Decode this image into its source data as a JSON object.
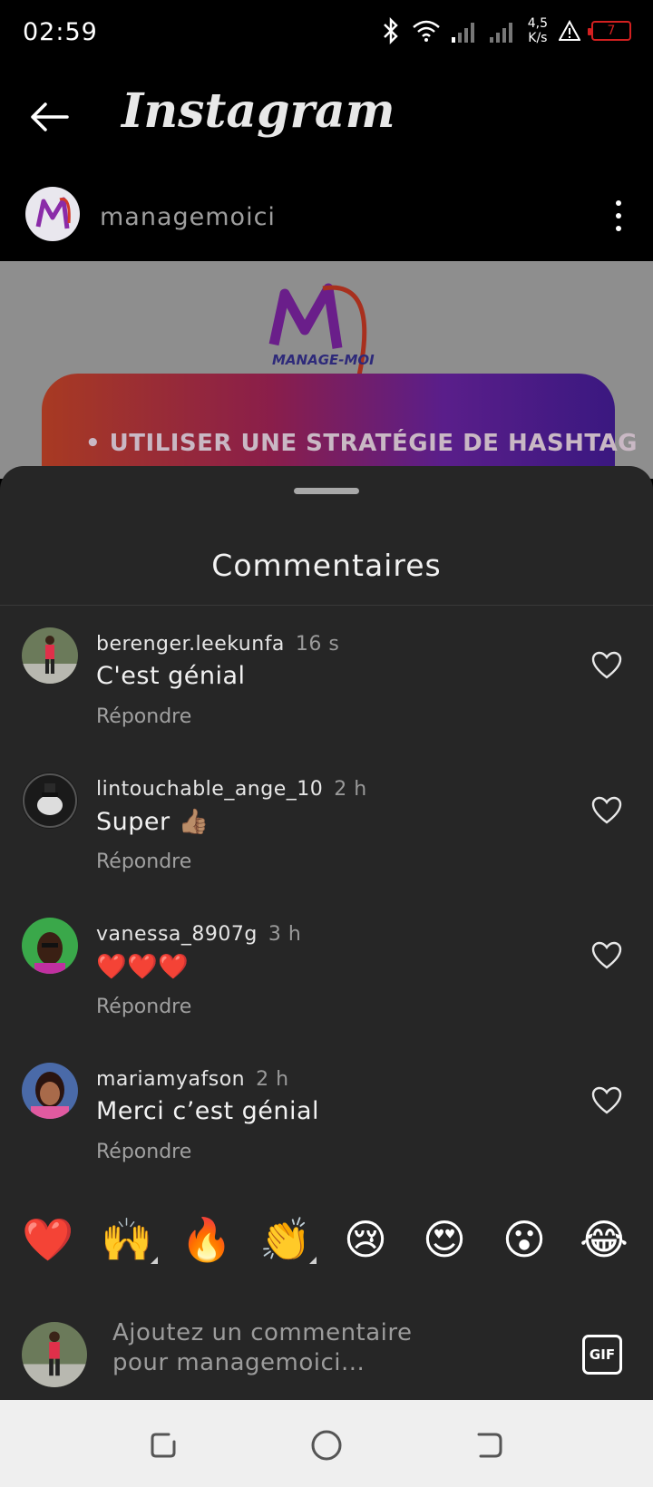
{
  "status_bar": {
    "time": "02:59",
    "speed_value": "4,5",
    "speed_unit": "K/s",
    "battery": "7",
    "icons": [
      "bluetooth-icon",
      "wifi-icon",
      "signal-icon",
      "signal-icon",
      "alert-icon",
      "battery-icon"
    ]
  },
  "header": {
    "title": "Instagram",
    "back_icon": "arrow-left-icon"
  },
  "post": {
    "username": "managemoici",
    "logo_text": "MANAGE-MOI",
    "banner_text": "• UTILISER UNE STRATÉGIE DE HASHTAG",
    "more_icon": "more-vertical-icon"
  },
  "comments_sheet": {
    "title": "Commentaires",
    "comments": [
      {
        "username": "berenger.leekunfa",
        "time": "16 s",
        "text": "C'est génial",
        "reply": "Répondre"
      },
      {
        "username": "lintouchable_ange_10",
        "time": "2 h",
        "text": "Super 👍🏽",
        "reply": "Répondre"
      },
      {
        "username": "vanessa_8907g",
        "time": "3 h",
        "text": "❤️❤️❤️",
        "reply": "Répondre"
      },
      {
        "username": "mariamyafson",
        "time": "2 h",
        "text": "Merci c’est génial",
        "reply": "Répondre"
      }
    ],
    "emojis": [
      "❤️",
      "🙌",
      "🔥",
      "👏",
      "😢",
      "😍",
      "😮",
      "😂"
    ],
    "input_placeholder": "Ajoutez un commentaire pour managemoici...",
    "gif_label": "GIF"
  },
  "colors": {
    "sheet_bg": "#262626",
    "text_primary": "#f2f2f2",
    "text_secondary": "#9a9a9a",
    "battery_low": "#d32020"
  }
}
